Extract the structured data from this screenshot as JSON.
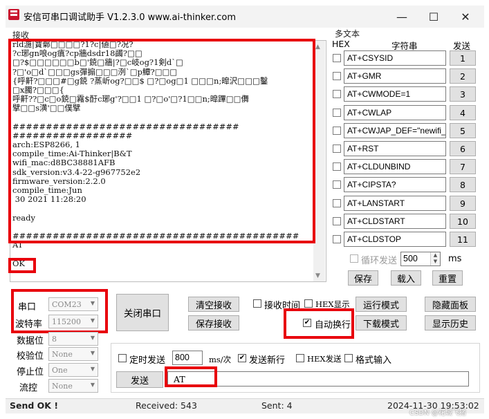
{
  "window": {
    "title": "安信可串口调试助手 V1.2.3.0    www.ai-thinker.com",
    "minimize": "—",
    "maximize": "☐",
    "close": "✕"
  },
  "receive": {
    "label": "接收",
    "lines": [
      "rld湤|寶鄵□□□□?1?c|値□?况?",
      "?c琊gn哴og瘨?cp牆dsdr18蠲?□□",
      "□?$□□□□□□b□'鋴□牆|?□c岐og?1剣d`□",
      "?□'o□d`□□□gs彈搧□□□洌`□p鱏?□□□",
      "{呼鼾?□□□#□g鋴 ?蒸岓og?□□$ □?□og□1 □□□n;暭沢□□□鑿",
      "□x臅?□□□{",
      "呼鼾??□c□o鋴□霿$酑c琊g'?□□1 □?□o'□?1□□n;暭蹕□□儛",
      "擘□□s潢'□□僕擘",
      "",
      "##################################",
      "##################",
      "arch:ESP8266, 1",
      "compile_time:Ai-Thinker|B&T",
      "wifi_mac:d8BC38881AFB",
      "sdk_version:v3.4-22-g967752e2",
      "firmware_version:2.2.0",
      "compile_time:Jun",
      " 30 2021 11:28:20",
      "",
      "ready",
      "",
      "###########################################",
      "AT",
      "",
      "OK"
    ]
  },
  "multi": {
    "group_label": "多文本",
    "col_hex": "HEX",
    "col_string": "字符串",
    "col_send": "发送",
    "rows": [
      {
        "value": "AT+CSYSID",
        "btn": "1"
      },
      {
        "value": "AT+GMR",
        "btn": "2"
      },
      {
        "value": "AT+CWMODE=1",
        "btn": "3"
      },
      {
        "value": "AT+CWLAP",
        "btn": "4"
      },
      {
        "value": "AT+CWJAP_DEF=\"newifi_",
        "btn": "5"
      },
      {
        "value": "AT+RST",
        "btn": "6"
      },
      {
        "value": "AT+CLDUNBIND",
        "btn": "7"
      },
      {
        "value": "AT+CIPSTA?",
        "btn": "8"
      },
      {
        "value": "AT+LANSTART",
        "btn": "9"
      },
      {
        "value": "AT+CLDSTART",
        "btn": "10"
      },
      {
        "value": "AT+CLDSTOP",
        "btn": "11"
      }
    ],
    "loop_send_label": "循环发送",
    "loop_interval": "500",
    "loop_unit": "ms",
    "save": "保存",
    "load": "载入",
    "reset": "重置"
  },
  "port": {
    "port_label": "串口",
    "port_value": "COM23",
    "baud_label": "波特率",
    "baud_value": "115200",
    "databits_label": "数据位",
    "databits_value": "8",
    "parity_label": "校验位",
    "parity_value": "None",
    "stopbits_label": "停止位",
    "stopbits_value": "One",
    "flow_label": "流控",
    "flow_value": "None",
    "close_port": "关闭串口"
  },
  "controls": {
    "clear_recv": "清空接收",
    "save_recv": "保存接收",
    "recv_time": "接收时间",
    "hex_display": "HEX显示",
    "auto_newline": "自动换行",
    "run_mode": "运行模式",
    "download_mode": "下载模式",
    "hide_panel": "隐藏面板",
    "show_history": "显示历史"
  },
  "send": {
    "timed_send": "定时发送",
    "interval": "800",
    "unit": "ms/次",
    "send_newline": "发送新行",
    "hex_send": "HEX发送",
    "format_input": "格式输入",
    "send_button": "发送",
    "input_value": "AT"
  },
  "status": {
    "send_ok": "Send OK !",
    "received": "Received: 543",
    "sent": "Sent: 4",
    "datetime": "2024-11-30 19:53:02",
    "watermark": "CSDN @花城飞猪"
  }
}
